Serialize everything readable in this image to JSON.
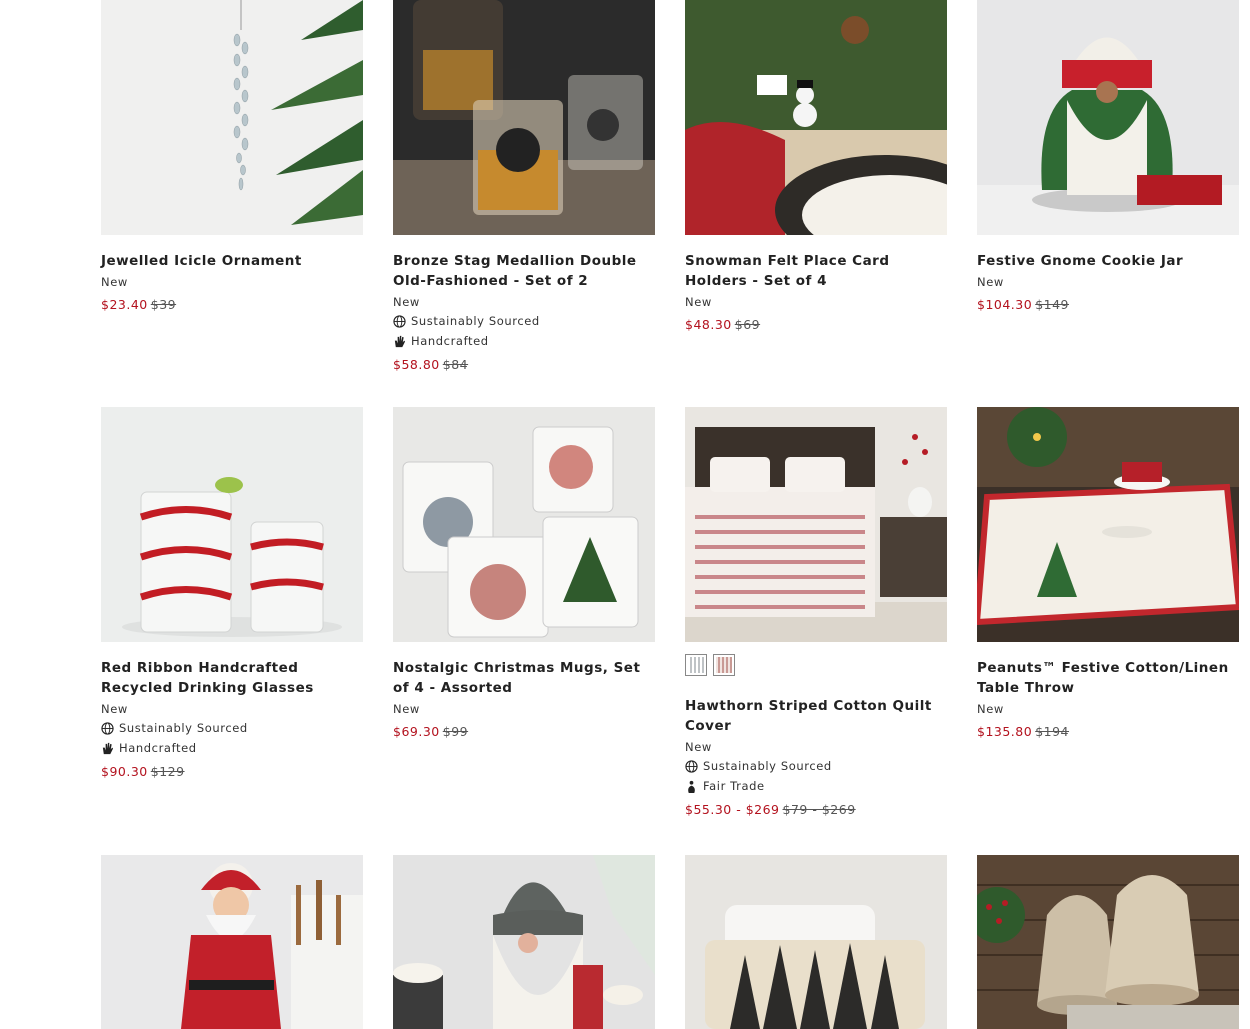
{
  "products": [
    {
      "title": "Jewelled Icicle Ornament",
      "new": "New",
      "sale": "$23.40",
      "orig": "$39"
    },
    {
      "title": "Bronze Stag Medallion Double Old-Fashioned - Set of 2",
      "new": "New",
      "attr1": "Sustainably Sourced",
      "attr2": "Handcrafted",
      "sale": "$58.80",
      "orig": "$84"
    },
    {
      "title": "Snowman Felt Place Card Holders - Set of 4",
      "new": "New",
      "sale": "$48.30",
      "orig": "$69"
    },
    {
      "title": "Festive Gnome Cookie Jar",
      "new": "New",
      "sale": "$104.30",
      "orig": "$149"
    },
    {
      "title": "Red Ribbon Handcrafted Recycled Drinking Glasses",
      "new": "New",
      "attr1": "Sustainably Sourced",
      "attr2": "Handcrafted",
      "sale": "$90.30",
      "orig": "$129"
    },
    {
      "title": "Nostalgic Christmas Mugs, Set of 4 - Assorted",
      "new": "New",
      "sale": "$69.30",
      "orig": "$99"
    },
    {
      "title": "Hawthorn Striped Cotton Quilt Cover",
      "new": "New",
      "attr1": "Sustainably Sourced",
      "attr2": "Fair Trade",
      "sale": "$55.30 - $269",
      "orig": "$79 - $269"
    },
    {
      "title": "Peanuts™ Festive Cotton/Linen Table Throw",
      "new": "New",
      "sale": "$135.80",
      "orig": "$194"
    }
  ],
  "colors": {
    "sale": "#b3121e",
    "text": "#222222"
  },
  "icons": {
    "sustainable": "globe-icon",
    "handcrafted": "hand-icon",
    "fair_trade": "fair-trade-icon"
  }
}
